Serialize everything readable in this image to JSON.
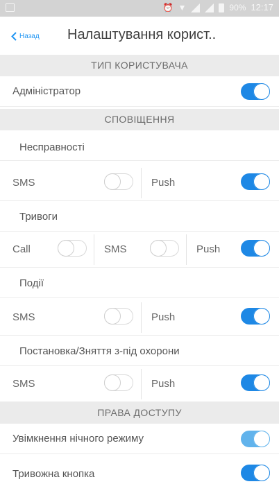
{
  "status_bar": {
    "battery": "90%",
    "time": "12:17"
  },
  "nav": {
    "back_label": "Назад",
    "title": "Налаштування корист.."
  },
  "sections": {
    "user_type": "ТИП КОРИСТУВАЧА",
    "notifications": "СПОВІЩЕННЯ",
    "access_rights": "ПРАВА ДОСТУПУ"
  },
  "user_type": {
    "admin_label": "Адміністратор",
    "admin_on": true
  },
  "notifications": {
    "faults": {
      "label": "Несправності",
      "sms_label": "SMS",
      "sms_on": false,
      "push_label": "Push",
      "push_on": true
    },
    "alarms": {
      "label": "Тривоги",
      "call_label": "Call",
      "call_on": false,
      "sms_label": "SMS",
      "sms_on": false,
      "push_label": "Push",
      "push_on": true
    },
    "events": {
      "label": "Події",
      "sms_label": "SMS",
      "sms_on": false,
      "push_label": "Push",
      "push_on": true
    },
    "arming": {
      "label": "Постановка/Зняття з-під охорони",
      "sms_label": "SMS",
      "sms_on": false,
      "push_label": "Push",
      "push_on": true
    }
  },
  "access_rights": {
    "night_mode": {
      "label": "Увімкнення нічного режиму",
      "on": true
    },
    "panic_button": {
      "label": "Тривожна кнопка",
      "on": true
    }
  }
}
